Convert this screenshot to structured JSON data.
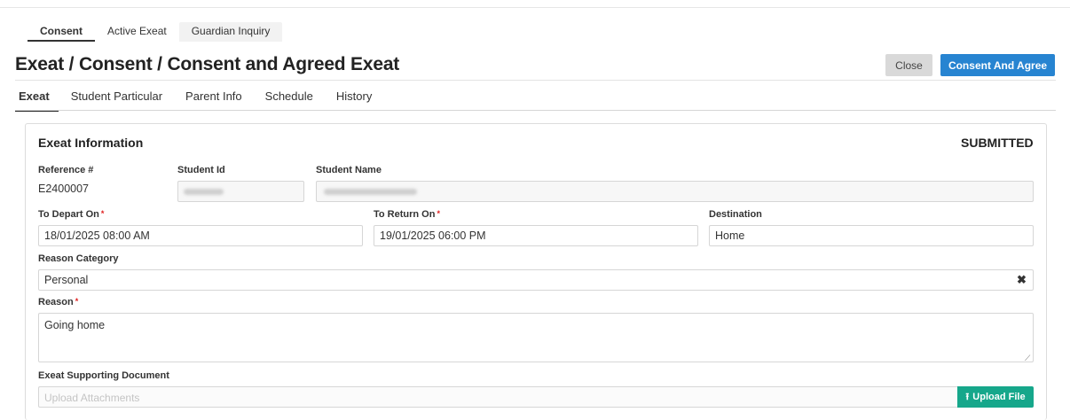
{
  "top_tabs": [
    {
      "label": "Consent"
    },
    {
      "label": "Active Exeat"
    },
    {
      "label": "Guardian Inquiry"
    }
  ],
  "page_title": "Exeat / Consent / Consent and Agreed Exeat",
  "actions": {
    "close_label": "Close",
    "consent_label": "Consent And Agree"
  },
  "sub_tabs": [
    {
      "label": "Exeat"
    },
    {
      "label": "Student Particular"
    },
    {
      "label": "Parent Info"
    },
    {
      "label": "Schedule"
    },
    {
      "label": "History"
    }
  ],
  "section": {
    "title": "Exeat Information",
    "status": "SUBMITTED"
  },
  "form": {
    "reference_label": "Reference #",
    "reference_value": "E2400007",
    "student_id_label": "Student Id",
    "student_name_label": "Student Name",
    "depart_label": "To Depart On",
    "depart_value": "18/01/2025 08:00 AM",
    "return_label": "To Return On",
    "return_value": "19/01/2025 06:00 PM",
    "destination_label": "Destination",
    "destination_value": "Home",
    "reason_category_label": "Reason Category",
    "reason_category_value": "Personal",
    "reason_label": "Reason",
    "reason_value": "Going home",
    "supporting_doc_label": "Exeat Supporting Document",
    "upload_placeholder": "Upload Attachments",
    "upload_button_label": "Upload File",
    "required_mark": "*"
  },
  "colors": {
    "primary": "#2784d1",
    "upload": "#16a78b",
    "required": "#e02020"
  },
  "icons": {
    "clear": "times-icon",
    "upload": "upload-icon",
    "resize": "resize-grip-icon"
  }
}
